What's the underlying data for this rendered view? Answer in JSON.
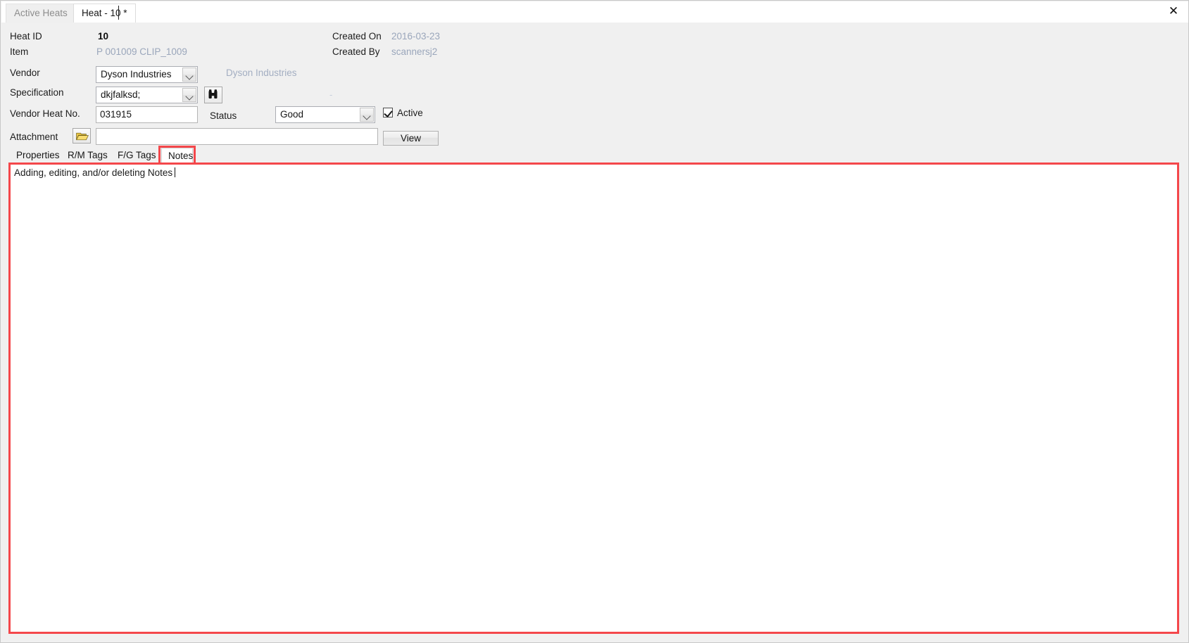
{
  "window": {
    "close_label": "✕"
  },
  "tabs": [
    {
      "label": "Active Heats",
      "active": false
    },
    {
      "label": "Heat - 10 *",
      "active": true
    }
  ],
  "form": {
    "heat_id_label": "Heat ID",
    "heat_id_value": "10",
    "item_label": "Item",
    "item_value": "P 001009 CLIP_1009",
    "created_on_label": "Created On",
    "created_on_value": "2016-03-23",
    "created_by_label": "Created By",
    "created_by_value": "scannersj2",
    "vendor_label": "Vendor",
    "vendor_value": "Dyson Industries",
    "vendor_display": "Dyson Industries",
    "specification_label": "Specification",
    "specification_value": "dkjfalksd;",
    "specification_display": "-",
    "search_icon": "binoculars-icon",
    "vendor_heat_no_label": "Vendor Heat No.",
    "vendor_heat_no_value": "031915",
    "status_label": "Status",
    "status_value": "Good",
    "active_label": "Active",
    "active_checked": true,
    "attachment_label": "Attachment",
    "attachment_browse_icon": "open-folder-icon",
    "attachment_value": "",
    "view_button_label": "View"
  },
  "inner_tabs": [
    {
      "label": "Properties",
      "selected": false
    },
    {
      "label": "R/M Tags",
      "selected": false
    },
    {
      "label": "F/G Tags",
      "selected": false
    },
    {
      "label": "Notes",
      "selected": true
    }
  ],
  "notes": {
    "text": "Adding, editing, and/or deleting Notes"
  },
  "highlight": {
    "color": "#f4474b"
  }
}
